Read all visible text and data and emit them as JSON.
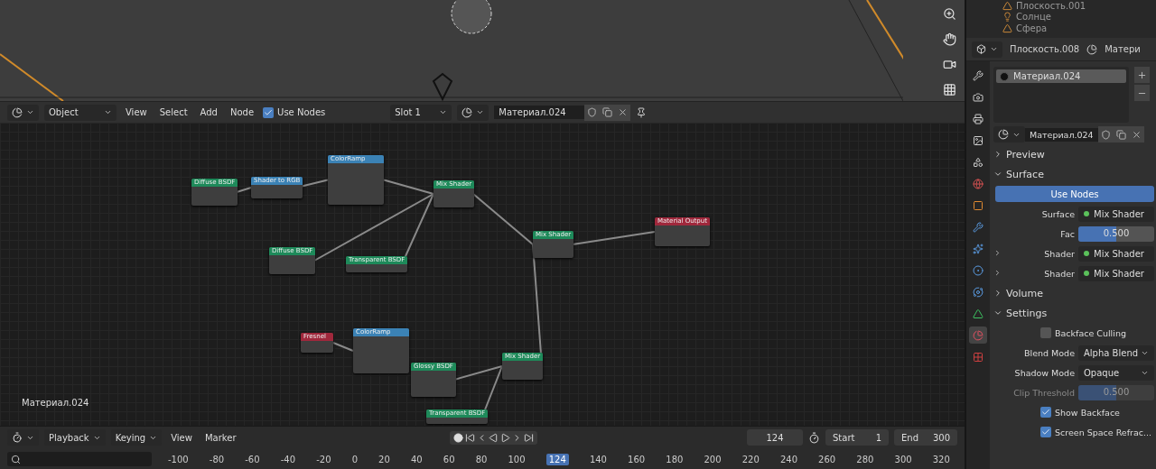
{
  "outliner": {
    "items": [
      {
        "label": "Плоскость.001",
        "kind": "mesh"
      },
      {
        "label": "Солнце",
        "kind": "light"
      },
      {
        "label": "Сфера",
        "kind": "mesh"
      }
    ]
  },
  "node_editor": {
    "header": {
      "mode": "Object",
      "menus": [
        "View",
        "Select",
        "Add",
        "Node"
      ],
      "use_nodes": {
        "label": "Use Nodes",
        "checked": true
      },
      "slot": "Slot 1",
      "material": "Материал.024"
    },
    "nodes": [
      {
        "title": "Diffuse BSDF",
        "kind": "shader"
      },
      {
        "title": "Shader to RGB",
        "kind": "converter"
      },
      {
        "title": "ColorRamp",
        "kind": "converter"
      },
      {
        "title": "Mix Shader",
        "kind": "shader"
      },
      {
        "title": "Mix Shader",
        "kind": "shader"
      },
      {
        "title": "Material Output",
        "kind": "output"
      },
      {
        "title": "Diffuse BSDF",
        "kind": "shader"
      },
      {
        "title": "Transparent BSDF",
        "kind": "shader"
      },
      {
        "title": "Fresnel",
        "kind": "input"
      },
      {
        "title": "ColorRamp",
        "kind": "converter"
      },
      {
        "title": "Glossy BSDF",
        "kind": "shader"
      },
      {
        "title": "Mix Shader",
        "kind": "shader"
      },
      {
        "title": "Transparent BSDF",
        "kind": "shader"
      }
    ],
    "canvas_label": "Материал.024"
  },
  "timeline": {
    "menus": [
      "Playback",
      "Keying",
      "View",
      "Marker"
    ],
    "current_frame": "124",
    "start_label": "Start",
    "start": "1",
    "end_label": "End",
    "end": "300",
    "ruler_frame": "124",
    "ticks": [
      "-100",
      "-80",
      "-60",
      "-40",
      "-20",
      "0",
      "20",
      "40",
      "60",
      "80",
      "100",
      "140",
      "160",
      "180",
      "200",
      "220",
      "240",
      "260",
      "280",
      "300",
      "320"
    ]
  },
  "properties": {
    "object": "Плоскость.008",
    "material_tab": "Матери",
    "slots": [
      {
        "label": "Материал.024",
        "selected": true
      }
    ],
    "material": "Материал.024",
    "panels": [
      {
        "title": "Preview",
        "expanded": false
      },
      {
        "title": "Surface",
        "expanded": true
      }
    ],
    "use_nodes_button": "Use Nodes",
    "surface": [
      {
        "kind": "link",
        "label": "Surface",
        "value": "Mix Shader",
        "expandable": false
      },
      {
        "kind": "slider",
        "label": "Fac",
        "value": "0.500",
        "level": 0.5
      },
      {
        "kind": "link",
        "label": "Shader",
        "value": "Mix Shader",
        "expandable": true
      },
      {
        "kind": "link",
        "label": "Shader",
        "value": "Mix Shader",
        "expandable": true
      }
    ],
    "panels2": [
      {
        "title": "Volume",
        "expanded": false
      },
      {
        "title": "Settings",
        "expanded": true
      }
    ],
    "settings": [
      {
        "kind": "check",
        "label": "Backface Culling",
        "checked": false
      },
      {
        "kind": "select",
        "label": "Blend Mode",
        "value": "Alpha Blend"
      },
      {
        "kind": "select",
        "label": "Shadow Mode",
        "value": "Opaque"
      },
      {
        "kind": "slider",
        "label": "Clip Threshold",
        "value": "0.500",
        "level": 0.5,
        "disabled": true
      },
      {
        "kind": "check",
        "label": "Show Backface",
        "checked": true
      },
      {
        "kind": "check",
        "label": "Screen Space Refrac...",
        "checked": true
      }
    ]
  }
}
